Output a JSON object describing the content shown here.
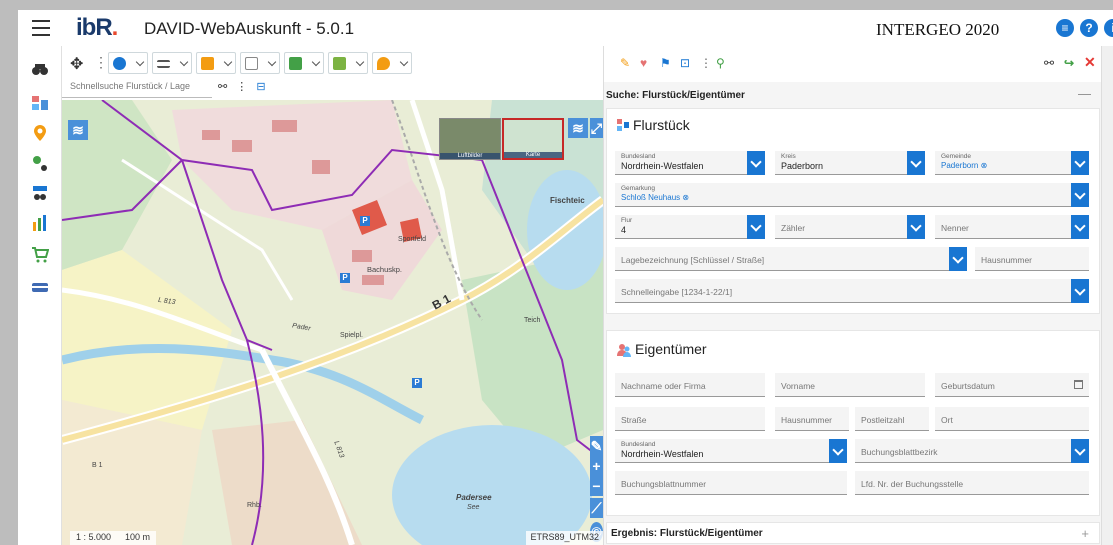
{
  "header": {
    "logo_text": "ibR",
    "logo_dot": ".",
    "app_title": "DAVID-WebAuskunft - 5.0.1",
    "event_title": "INTERGEO 2020",
    "btn_list": "≡",
    "btn_help": "?",
    "btn_info": "i"
  },
  "map": {
    "quicksearch_placeholder": "Schnellsuche Flurstück / Lage",
    "basemap_air": "Luftbilder",
    "basemap_map": "Karte",
    "scale": "1 : 5.000",
    "scale_bar": "100 m",
    "crs": "ETRS89_UTM32",
    "labels": {
      "b1": "B 1",
      "fischteich": "Fischteic",
      "bachuskp": "Bachuskp.",
      "padersee": "Padersee",
      "see": "See",
      "pader": "Pader",
      "l813a": "L 813",
      "l813b": "L 813",
      "teich": "Teich",
      "spielpl": "Spielpl.",
      "sportfeld": "Sportfeld",
      "rhb": "Rhb.",
      "b1small": "B 1"
    },
    "ctrl_plus": "+",
    "ctrl_minus": "−",
    "ctrl_copyright": "©"
  },
  "panel": {
    "title": "Suche: Flurstück/Eigentümer",
    "collapse": "—",
    "flurstueck": {
      "title": "Flurstück",
      "bundesland_label": "Bundesland",
      "bundesland_value": "Nordrhein-Westfalen",
      "kreis_label": "Kreis",
      "kreis_value": "Paderborn",
      "gemeinde_label": "Gemeinde",
      "gemeinde_value": "Paderborn ⊗",
      "gemarkung_label": "Gemarkung",
      "gemarkung_value": "Schloß Neuhaus ⊗",
      "flur_label": "Flur",
      "flur_value": "4",
      "zaehler_ph": "Zähler",
      "nenner_ph": "Nenner",
      "lage_ph": "Lagebezeichnung [Schlüssel / Straße]",
      "hausnummer_ph": "Hausnummer",
      "schnell_ph": "Schnelleingabe [1234-1-22/1]"
    },
    "eigentuemer": {
      "title": "Eigentümer",
      "name_ph": "Nachname oder Firma",
      "vorname_ph": "Vorname",
      "geburt_ph": "Geburtsdatum",
      "strasse_ph": "Straße",
      "hausnr_ph": "Hausnummer",
      "plz_ph": "Postleitzahl",
      "ort_ph": "Ort",
      "bundesland_label": "Bundesland",
      "bundesland_value": "Nordrhein-Westfalen",
      "bezirk_ph": "Buchungsblattbezirk",
      "blattnr_ph": "Buchungsblattnummer",
      "lfdnr_ph": "Lfd. Nr. der Buchungsstelle"
    },
    "result_title": "Ergebnis: Flurstück/Eigentümer",
    "result_expand": "+"
  },
  "colors": {
    "accent": "#1976d2",
    "close": "#e53935",
    "route": "#7b1fa2"
  }
}
